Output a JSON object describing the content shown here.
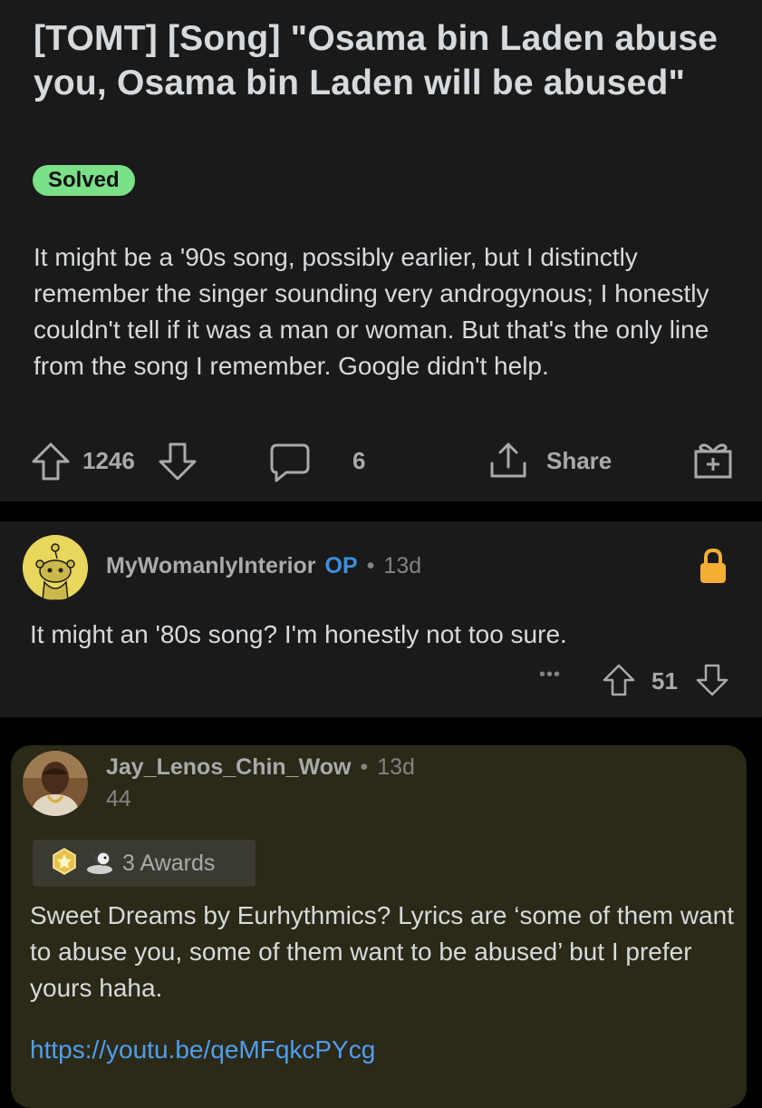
{
  "post": {
    "title": "[TOMT] [Song] \"Osama bin Laden abuse you, Osama bin Laden will be abused\"",
    "flair": "Solved",
    "body": "It might be a '90s song, possibly earlier, but I distinctly remember the singer sounding very androgynous; I honestly couldn't tell if it was a man or woman. But that's the only line from the song I remember. Google didn't help.",
    "votes": "1246",
    "comments": "6",
    "share_label": "Share"
  },
  "comment1": {
    "username": "MyWomanlyInterior",
    "op_badge": "OP",
    "separator": "•",
    "age": "13d",
    "text": "It might an '80s song? I'm honestly not too sure.",
    "more": "•••",
    "votes": "51"
  },
  "comment2": {
    "username": "Jay_Lenos_Chin_Wow",
    "separator": "•",
    "age": "13d",
    "flair_number": "44",
    "awards_label": "3 Awards",
    "text": "Sweet Dreams by Eurhythmics? Lyrics are ‘some of them want to abuse you, some of them want to be abused’ but I prefer yours haha.",
    "link": "https://youtu.be/qeMFqkcPYcg"
  },
  "colors": {
    "background": "#000000",
    "card": "#1a1a1b",
    "highlight_card": "#2b2917",
    "solved_flair": "#7be188",
    "op": "#3d8fe0",
    "link": "#4f9ef0",
    "lock": "#f5ae34"
  },
  "icons": [
    "upvote-icon",
    "downvote-icon",
    "comment-icon",
    "share-icon",
    "gift-icon",
    "lock-icon",
    "more-icon",
    "award-icon"
  ]
}
